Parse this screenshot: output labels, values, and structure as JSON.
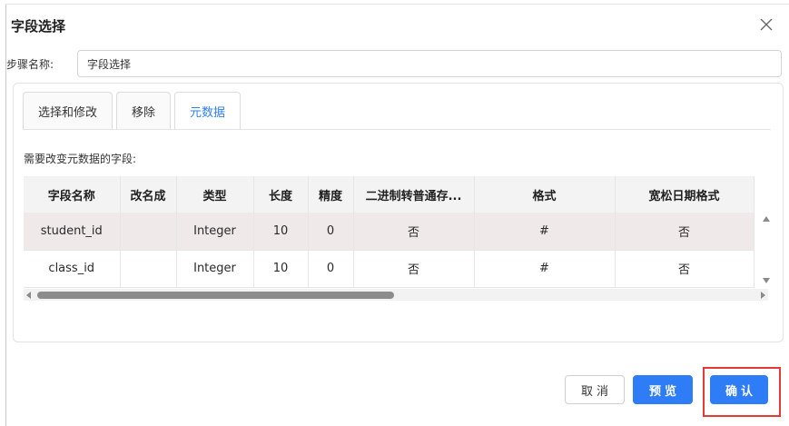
{
  "dialog": {
    "title": "字段选择"
  },
  "step": {
    "label": "步骤名称:",
    "value": "字段选择"
  },
  "tabs": [
    {
      "label": "选择和修改",
      "active": false
    },
    {
      "label": "移除",
      "active": false
    },
    {
      "label": "元数据",
      "active": true
    }
  ],
  "metadata": {
    "section_label": "需要改变元数据的字段:",
    "columns": [
      "字段名称",
      "改名成",
      "类型",
      "长度",
      "精度",
      "二进制转普通存...",
      "格式",
      "宽松日期格式"
    ],
    "rows": [
      [
        "student_id",
        "",
        "Integer",
        "10",
        "0",
        "否",
        "#",
        "否"
      ],
      [
        "class_id",
        "",
        "Integer",
        "10",
        "0",
        "否",
        "#",
        "否"
      ]
    ],
    "selected_row": 0
  },
  "footer": {
    "cancel_label": "取消",
    "preview_label": "预览",
    "confirm_label": "确认"
  },
  "colors": {
    "accent": "#2e7cf6",
    "highlight": "#e53935"
  },
  "icons": {
    "close": "close-icon"
  }
}
